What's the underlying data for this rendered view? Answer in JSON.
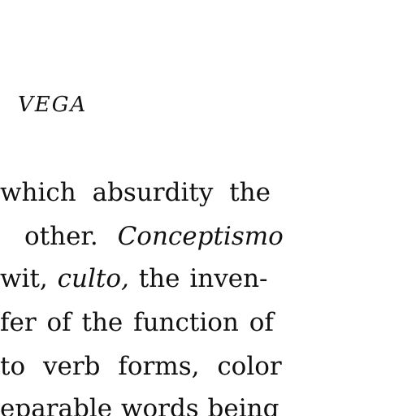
{
  "running_head": "VEGA",
  "lines": [
    "which absurdity the",
    "other.",
    "Conceptismo",
    "wit,",
    "culto,",
    "the inven-",
    "fer of the function of",
    "to verb forms, color",
    "eparable words being"
  ]
}
